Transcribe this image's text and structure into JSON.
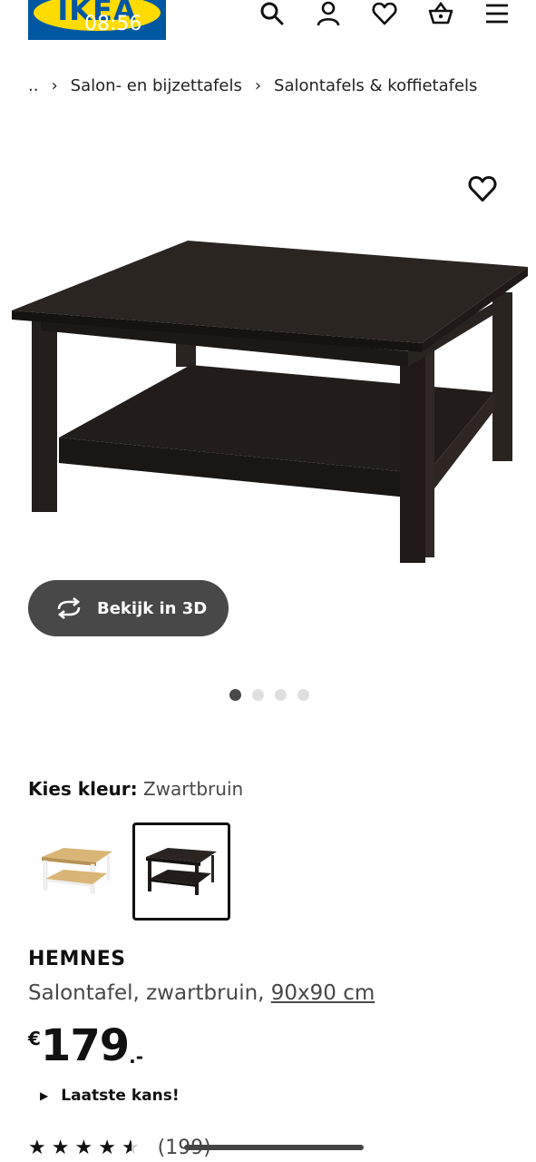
{
  "brand": {
    "logo_text": "IKEA",
    "primary_color": "#0058a3",
    "accent_color": "#ffdb00"
  },
  "status_bar": {
    "time": "08:56"
  },
  "header_icons": [
    "search-icon",
    "account-icon",
    "heart-icon",
    "basket-icon",
    "menu-icon"
  ],
  "breadcrumb": {
    "ellipsis": "..",
    "separator": "›",
    "items": [
      "Salon- en bijzettafels",
      "Salontafels & koffietafels"
    ]
  },
  "gallery": {
    "view_3d_label": "Bekijk in 3D",
    "image_count": 4,
    "active_image": 1
  },
  "color_selector": {
    "label": "Kies kleur:",
    "selected": "Zwartbruin",
    "swatches": [
      {
        "color": "#d9b577",
        "selected": false
      },
      {
        "color": "#2a2421",
        "selected": true
      }
    ]
  },
  "product": {
    "name": "HEMNES",
    "description": "Salontafel, zwartbruin,",
    "size": "90x90 cm",
    "price": {
      "currency": "€",
      "amount": "179",
      "decimal": ".-"
    },
    "availability_note": "Laatste kans!",
    "rating": {
      "stars": 4.5,
      "count_text": "(199)"
    }
  }
}
